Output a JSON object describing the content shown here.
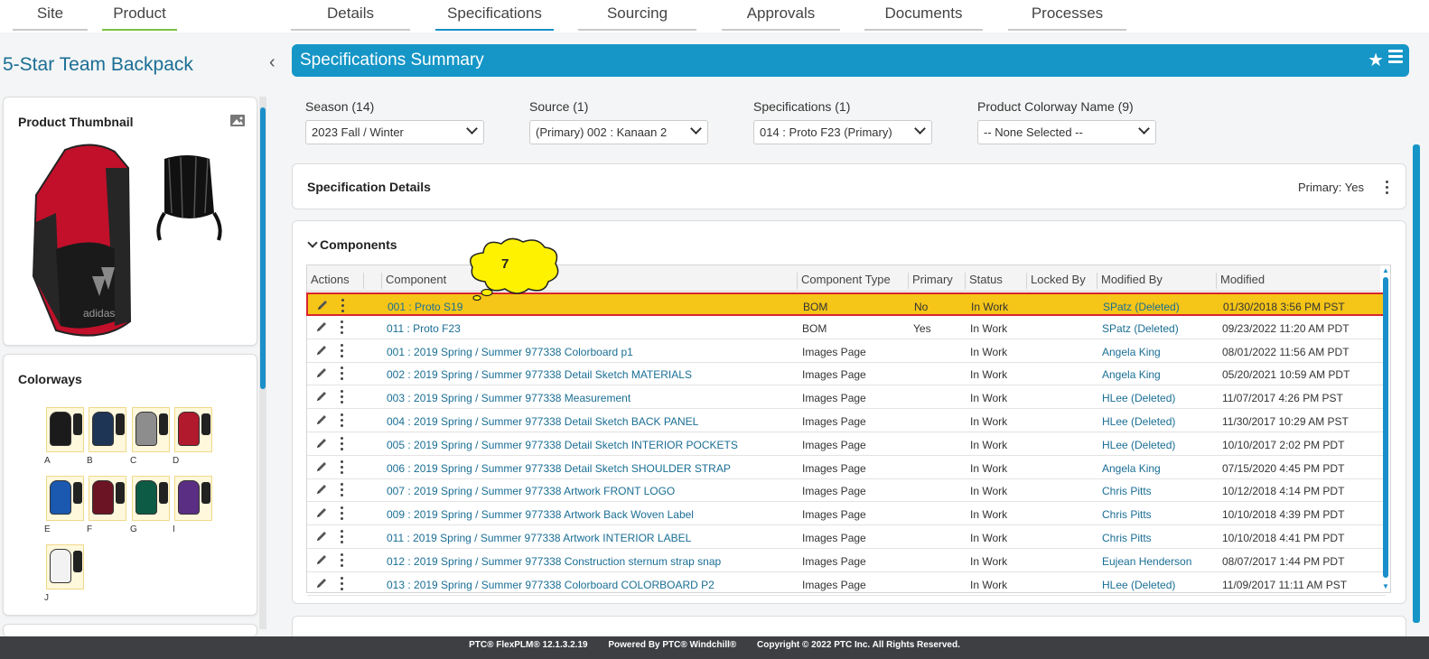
{
  "top_tabs": [
    {
      "label": "Site"
    },
    {
      "label": "Product"
    },
    {
      "label": "Details"
    },
    {
      "label": "Specifications"
    },
    {
      "label": "Sourcing"
    },
    {
      "label": "Approvals"
    },
    {
      "label": "Documents"
    },
    {
      "label": "Processes"
    }
  ],
  "product": {
    "title": "5-Star Team Backpack",
    "thumbnail_title": "Product Thumbnail",
    "colorways_title": "Colorways",
    "colorways": [
      {
        "label": "A",
        "color": "#1b1b1b"
      },
      {
        "label": "B",
        "color": "#1f3556"
      },
      {
        "label": "C",
        "color": "#8d8d8d"
      },
      {
        "label": "D",
        "color": "#b1192c"
      },
      {
        "label": "E",
        "color": "#1b58b0"
      },
      {
        "label": "F",
        "color": "#6b1424"
      },
      {
        "label": "G",
        "color": "#0e5b45"
      },
      {
        "label": "I",
        "color": "#5a2f83"
      },
      {
        "label": "J",
        "color": "#f2f2f2"
      }
    ]
  },
  "summary": {
    "title": "Specifications Summary"
  },
  "filters": {
    "season_label": "Season (14)",
    "season_value": "2023 Fall / Winter",
    "source_label": "Source (1)",
    "source_value": "(Primary) 002 : Kanaan 2",
    "spec_label": "Specifications (1)",
    "spec_value": "014 : Proto F23 (Primary)",
    "colorway_label": "Product Colorway Name (9)",
    "colorway_value": "-- None Selected --"
  },
  "spec_details": {
    "title": "Specification Details",
    "primary": "Primary: Yes"
  },
  "components": {
    "title": "Components",
    "callout_number": "7",
    "columns": [
      "Actions",
      "Component",
      "Component Type",
      "Primary",
      "Status",
      "Locked By",
      "Modified By",
      "Modified"
    ],
    "rows": [
      {
        "component": "001 : Proto S19",
        "type": "BOM",
        "primary": "No",
        "status": "In Work",
        "locked_by": "",
        "modified_by": "SPatz (Deleted)",
        "modified": "01/30/2018 3:56 PM PST"
      },
      {
        "component": "011 : Proto F23",
        "type": "BOM",
        "primary": "Yes",
        "status": "In Work",
        "locked_by": "",
        "modified_by": "SPatz (Deleted)",
        "modified": "09/23/2022 11:20 AM PDT"
      },
      {
        "component": "001 : 2019 Spring / Summer  977338 Colorboard p1",
        "type": "Images Page",
        "primary": "",
        "status": "In Work",
        "locked_by": "",
        "modified_by": "Angela King",
        "modified": "08/01/2022 11:56 AM PDT"
      },
      {
        "component": "002 : 2019 Spring / Summer  977338 Detail Sketch MATERIALS",
        "type": "Images Page",
        "primary": "",
        "status": "In Work",
        "locked_by": "",
        "modified_by": "Angela King",
        "modified": "05/20/2021 10:59 AM PDT"
      },
      {
        "component": "003 : 2019 Spring / Summer  977338 Measurement",
        "type": "Images Page",
        "primary": "",
        "status": "In Work",
        "locked_by": "",
        "modified_by": "HLee (Deleted)",
        "modified": "11/07/2017 4:26 PM PST"
      },
      {
        "component": "004 : 2019 Spring / Summer  977338 Detail Sketch BACK PANEL",
        "type": "Images Page",
        "primary": "",
        "status": "In Work",
        "locked_by": "",
        "modified_by": "HLee (Deleted)",
        "modified": "11/30/2017 10:29 AM PST"
      },
      {
        "component": "005 : 2019 Spring / Summer  977338 Detail Sketch INTERIOR POCKETS",
        "type": "Images Page",
        "primary": "",
        "status": "In Work",
        "locked_by": "",
        "modified_by": "HLee (Deleted)",
        "modified": "10/10/2017 2:02 PM PDT"
      },
      {
        "component": "006 : 2019 Spring / Summer  977338 Detail Sketch SHOULDER STRAP",
        "type": "Images Page",
        "primary": "",
        "status": "In Work",
        "locked_by": "",
        "modified_by": "Angela King",
        "modified": "07/15/2020 4:45 PM PDT"
      },
      {
        "component": "007 : 2019 Spring / Summer  977338 Artwork FRONT LOGO",
        "type": "Images Page",
        "primary": "",
        "status": "In Work",
        "locked_by": "",
        "modified_by": "Chris Pitts",
        "modified": "10/12/2018 4:14 PM PDT"
      },
      {
        "component": "009 : 2019 Spring / Summer  977338 Artwork Back Woven Label",
        "type": "Images Page",
        "primary": "",
        "status": "In Work",
        "locked_by": "",
        "modified_by": "Chris Pitts",
        "modified": "10/10/2018 4:39 PM PDT"
      },
      {
        "component": "011 : 2019 Spring / Summer  977338 Artwork INTERIOR LABEL",
        "type": "Images Page",
        "primary": "",
        "status": "In Work",
        "locked_by": "",
        "modified_by": "Chris Pitts",
        "modified": "10/10/2018 4:41 PM PDT"
      },
      {
        "component": "012 : 2019 Spring / Summer  977338 Construction sternum strap snap",
        "type": "Images Page",
        "primary": "",
        "status": "In Work",
        "locked_by": "",
        "modified_by": "Eujean Henderson",
        "modified": "08/07/2017 1:44 PM PDT"
      },
      {
        "component": "013 : 2019 Spring / Summer  977338 Colorboard COLORBOARD P2",
        "type": "Images Page",
        "primary": "",
        "status": "In Work",
        "locked_by": "",
        "modified_by": "HLee (Deleted)",
        "modified": "11/09/2017 11:11 AM PST"
      }
    ]
  },
  "footer": {
    "version": "PTC® FlexPLM® 12.1.3.2.19",
    "powered": "Powered By PTC® Windchill®",
    "copyright": "Copyright © 2022 PTC Inc. All Rights Reserved."
  }
}
